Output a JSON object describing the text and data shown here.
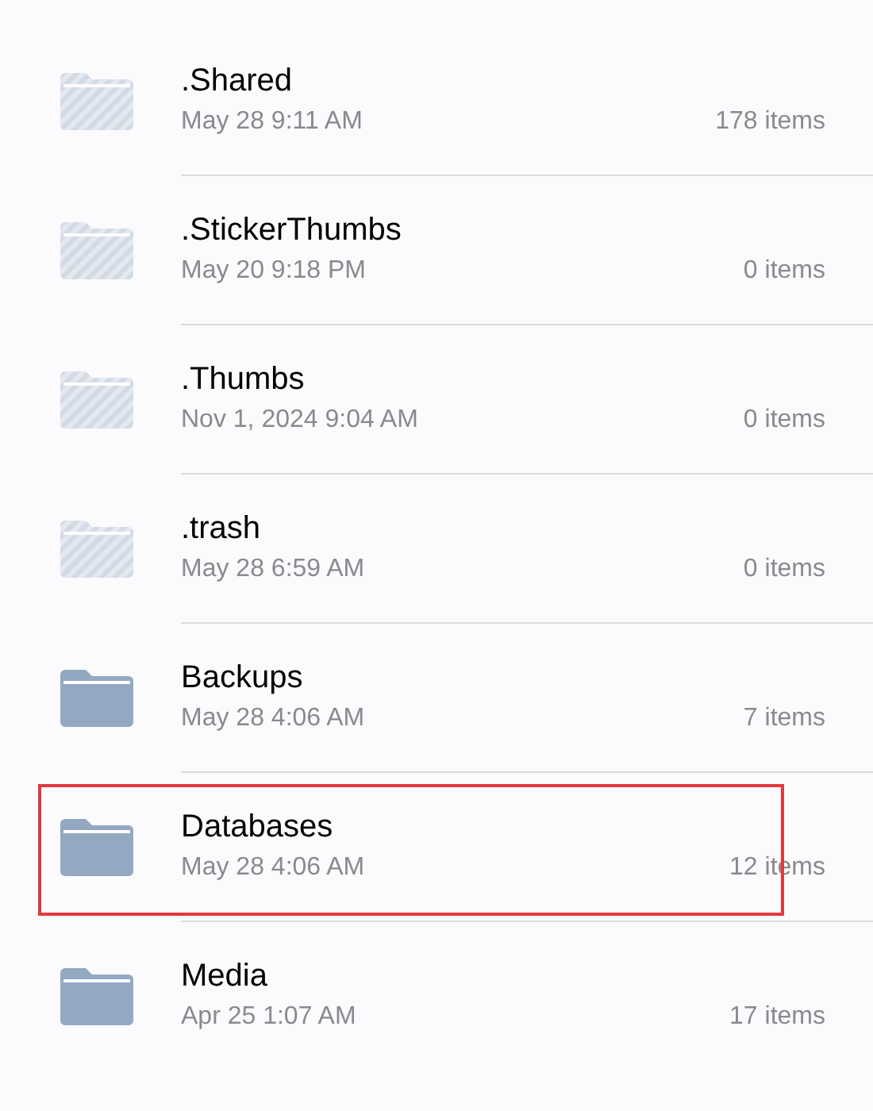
{
  "folders": [
    {
      "name": ".Shared",
      "date": "May 28 9:11 AM",
      "count": "178 items",
      "hidden": true,
      "highlighted": false
    },
    {
      "name": ".StickerThumbs",
      "date": "May 20 9:18 PM",
      "count": "0 items",
      "hidden": true,
      "highlighted": false
    },
    {
      "name": ".Thumbs",
      "date": "Nov 1, 2024 9:04 AM",
      "count": "0 items",
      "hidden": true,
      "highlighted": false
    },
    {
      "name": ".trash",
      "date": "May 28 6:59 AM",
      "count": "0 items",
      "hidden": true,
      "highlighted": false
    },
    {
      "name": "Backups",
      "date": "May 28 4:06 AM",
      "count": "7 items",
      "hidden": false,
      "highlighted": false
    },
    {
      "name": "Databases",
      "date": "May 28 4:06 AM",
      "count": "12 items",
      "hidden": false,
      "highlighted": true
    },
    {
      "name": "Media",
      "date": "Apr 25 1:07 AM",
      "count": "17 items",
      "hidden": false,
      "highlighted": false
    }
  ]
}
